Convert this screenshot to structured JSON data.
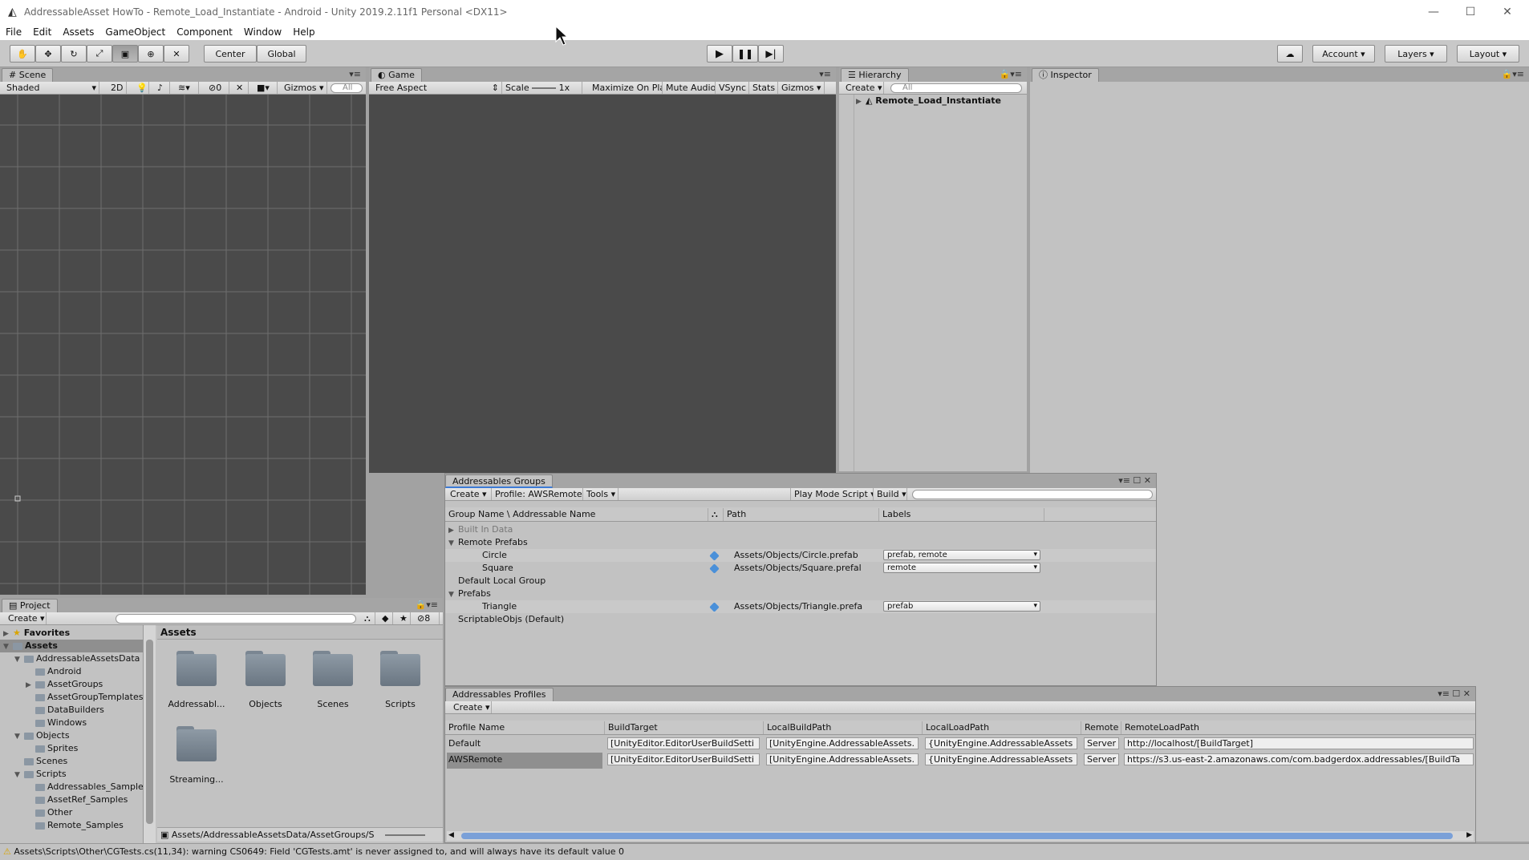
{
  "window": {
    "title": "AddressableAsset HowTo - Remote_Load_Instantiate - Android - Unity 2019.2.11f1 Personal <DX11>",
    "controls": {
      "minimize": "—",
      "maximize": "☐",
      "close": "✕"
    }
  },
  "menu": [
    "File",
    "Edit",
    "Assets",
    "GameObject",
    "Component",
    "Window",
    "Help"
  ],
  "toolbar": {
    "tools": [
      "hand-icon",
      "move-icon",
      "rotate-icon",
      "scale-icon",
      "rect-icon",
      "transform-icon",
      "custom-tool-icon"
    ],
    "pivot": "Center",
    "space": "Global",
    "account": "Account",
    "layers": "Layers",
    "layout": "Layout"
  },
  "scene": {
    "tab": "Scene",
    "shading": "Shaded",
    "mode2d": "2D",
    "hidden_count": "0",
    "gizmos": "Gizmos",
    "search_placeholder": "All"
  },
  "game": {
    "tab": "Game",
    "aspect": "Free Aspect",
    "scale_label": "Scale",
    "scale_value": "1x",
    "buttons": [
      "Maximize On Play",
      "Mute Audio",
      "VSync",
      "Stats",
      "Gizmos"
    ]
  },
  "hierarchy": {
    "tab": "Hierarchy",
    "create": "Create",
    "search_placeholder": "All",
    "scene_name": "Remote_Load_Instantiate"
  },
  "inspector": {
    "tab": "Inspector"
  },
  "project": {
    "tab": "Project",
    "create": "Create",
    "hidden_count": "8",
    "favorites": "Favorites",
    "tree": [
      {
        "label": "Assets",
        "indent": 0,
        "arrow": "▼",
        "bold": true
      },
      {
        "label": "AddressableAssetsData",
        "indent": 1,
        "arrow": "▼"
      },
      {
        "label": "Android",
        "indent": 2,
        "arrow": ""
      },
      {
        "label": "AssetGroups",
        "indent": 2,
        "arrow": "▶"
      },
      {
        "label": "AssetGroupTemplates",
        "indent": 2,
        "arrow": ""
      },
      {
        "label": "DataBuilders",
        "indent": 2,
        "arrow": ""
      },
      {
        "label": "Windows",
        "indent": 2,
        "arrow": ""
      },
      {
        "label": "Objects",
        "indent": 1,
        "arrow": "▼"
      },
      {
        "label": "Sprites",
        "indent": 2,
        "arrow": ""
      },
      {
        "label": "Scenes",
        "indent": 1,
        "arrow": ""
      },
      {
        "label": "Scripts",
        "indent": 1,
        "arrow": "▼"
      },
      {
        "label": "Addressables_Samples",
        "indent": 2,
        "arrow": ""
      },
      {
        "label": "AssetRef_Samples",
        "indent": 2,
        "arrow": ""
      },
      {
        "label": "Other",
        "indent": 2,
        "arrow": ""
      },
      {
        "label": "Remote_Samples",
        "indent": 2,
        "arrow": ""
      }
    ],
    "grid_title": "Assets",
    "folders": [
      "Addressabl...",
      "Objects",
      "Scenes",
      "Scripts",
      "Streaming..."
    ],
    "path": "Assets/AddressableAssetsData/AssetGroups/S"
  },
  "groups": {
    "tab": "Addressables Groups",
    "toolbar": {
      "create": "Create",
      "profile": "Profile: AWSRemote",
      "tools": "Tools",
      "play_mode": "Play Mode Script",
      "build": "Build"
    },
    "columns": {
      "name": "Group Name \\ Addressable Name",
      "path": "Path",
      "labels": "Labels"
    },
    "rows": [
      {
        "kind": "group",
        "name": "Built In Data",
        "arrow": "▶",
        "dim": true
      },
      {
        "kind": "group",
        "name": "Remote Prefabs",
        "arrow": "▼"
      },
      {
        "kind": "entry",
        "name": "Circle",
        "path": "Assets/Objects/Circle.prefab",
        "labels": "prefab, remote"
      },
      {
        "kind": "entry",
        "name": "Square",
        "path": "Assets/Objects/Square.prefal",
        "labels": "remote"
      },
      {
        "kind": "group",
        "name": "Default Local Group",
        "arrow": ""
      },
      {
        "kind": "group",
        "name": "Prefabs",
        "arrow": "▼"
      },
      {
        "kind": "entry",
        "name": "Triangle",
        "path": "Assets/Objects/Triangle.prefa",
        "labels": "prefab"
      },
      {
        "kind": "group",
        "name": "ScriptableObjs (Default)",
        "arrow": ""
      }
    ]
  },
  "profiles": {
    "tab": "Addressables Profiles",
    "create": "Create",
    "columns": [
      "Profile Name",
      "BuildTarget",
      "LocalBuildPath",
      "LocalLoadPath",
      "Remote",
      "RemoteLoadPath"
    ],
    "rows": [
      {
        "name": "Default",
        "cells": [
          "[UnityEditor.EditorUserBuildSetti",
          "[UnityEngine.AddressableAssets.",
          "{UnityEngine.AddressableAssets",
          "Server",
          "http://localhost/[BuildTarget]"
        ]
      },
      {
        "name": "AWSRemote",
        "cells": [
          "[UnityEditor.EditorUserBuildSetti",
          "[UnityEngine.AddressableAssets.",
          "{UnityEngine.AddressableAssets",
          "Server",
          "https://s3.us-east-2.amazonaws.com/com.badgerdox.addressables/[BuildTa"
        ]
      }
    ]
  },
  "status": {
    "message": "Assets\\Scripts\\Other\\CGTests.cs(11,34): warning CS0649: Field 'CGTests.amt' is never assigned to, and will always have its default value 0"
  }
}
